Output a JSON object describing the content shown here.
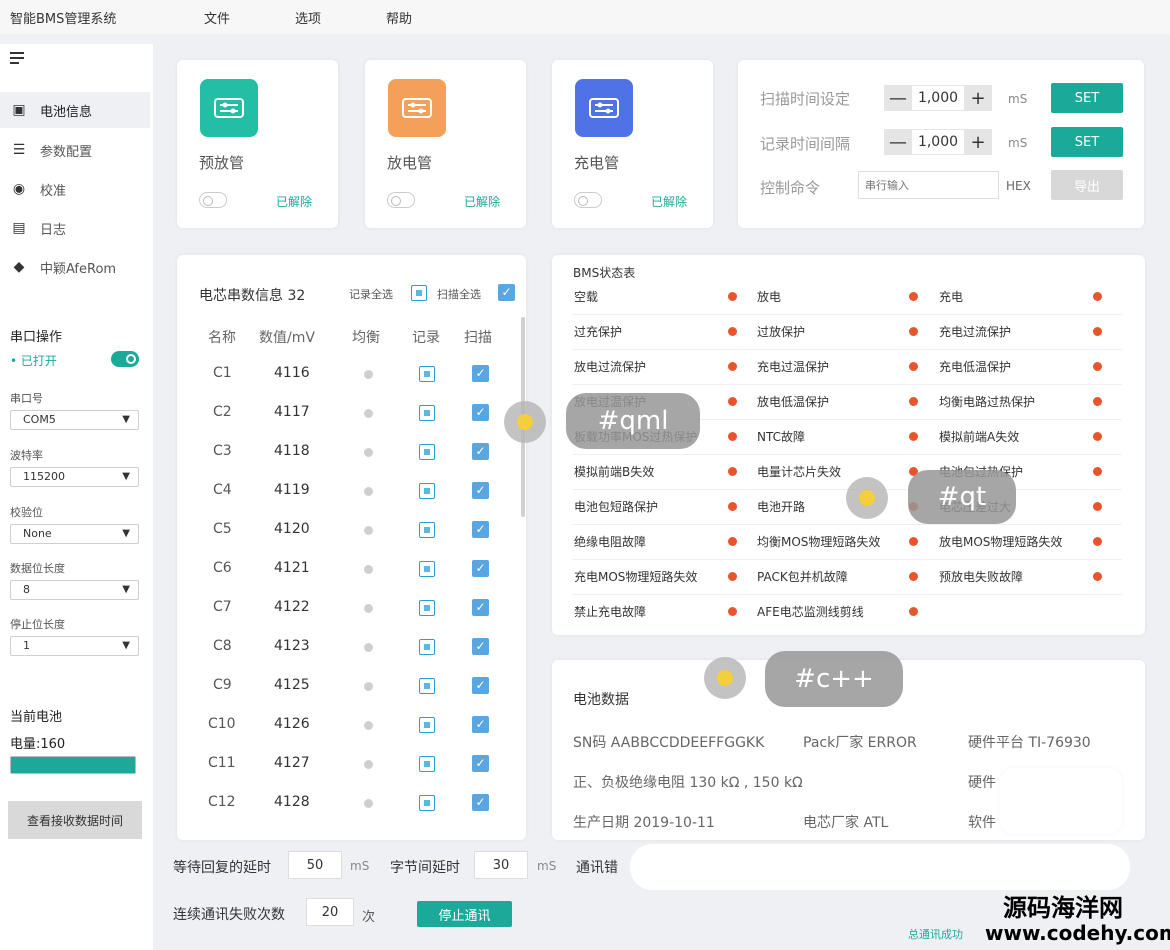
{
  "app": {
    "title": "智能BMS管理系统"
  },
  "menu": [
    "文件",
    "选项",
    "帮助"
  ],
  "sidebar": {
    "items": [
      {
        "label": "电池信息",
        "icon": "battery-icon"
      },
      {
        "label": "参数配置",
        "icon": "sliders-icon"
      },
      {
        "label": "校准",
        "icon": "target-icon"
      },
      {
        "label": "日志",
        "icon": "log-icon"
      },
      {
        "label": "中颖AfeRom",
        "icon": "chip-icon"
      }
    ],
    "serial": {
      "title": "串口操作",
      "status": "• 已打开",
      "port_label": "串口号",
      "port_value": "COM5",
      "baud_label": "波特率",
      "baud_value": "115200",
      "parity_label": "校验位",
      "parity_value": "None",
      "databits_label": "数据位长度",
      "databits_value": "8",
      "stopbits_label": "停止位长度",
      "stopbits_value": "1"
    },
    "battery": {
      "title": "当前电池",
      "level_label": "电量:160",
      "level_fraction": 1.0
    },
    "view_button": "查看接收数据时间"
  },
  "switches": [
    {
      "label": "预放管",
      "status": "已解除",
      "color": "#22bfa5"
    },
    {
      "label": "放电管",
      "status": "已解除",
      "color": "#f5a05a"
    },
    {
      "label": "充电管",
      "status": "已解除",
      "color": "#4f73e6"
    }
  ],
  "controls": {
    "scan_label": "扫描时间设定",
    "scan_value": "1,000",
    "scan_unit": "mS",
    "record_label": "记录时间间隔",
    "record_value": "1,000",
    "record_unit": "mS",
    "set_label": "SET",
    "cmd_label": "控制命令",
    "cmd_placeholder": "串行输入",
    "cmd_unit": "HEX",
    "export_label": "导出",
    "minus": "—",
    "plus": "+"
  },
  "cells": {
    "title": "电芯串数信息 32",
    "record_all": "记录全选",
    "scan_all": "扫描全选",
    "headers": [
      "名称",
      "数值/mV",
      "均衡",
      "记录",
      "扫描"
    ],
    "rows": [
      {
        "name": "C1",
        "value": "4116"
      },
      {
        "name": "C2",
        "value": "4117"
      },
      {
        "name": "C3",
        "value": "4118"
      },
      {
        "name": "C4",
        "value": "4119"
      },
      {
        "name": "C5",
        "value": "4120"
      },
      {
        "name": "C6",
        "value": "4121"
      },
      {
        "name": "C7",
        "value": "4122"
      },
      {
        "name": "C8",
        "value": "4123"
      },
      {
        "name": "C9",
        "value": "4125"
      },
      {
        "name": "C10",
        "value": "4126"
      },
      {
        "name": "C11",
        "value": "4127"
      },
      {
        "name": "C12",
        "value": "4128"
      }
    ]
  },
  "status_table": {
    "title": "BMS状态表",
    "rows": [
      [
        "空载",
        "放电",
        "充电"
      ],
      [
        "过充保护",
        "过放保护",
        "充电过流保护"
      ],
      [
        "放电过流保护",
        "充电过温保护",
        "充电低温保护"
      ],
      [
        "放电过温保护",
        "放电低温保护",
        "均衡电路过热保护"
      ],
      [
        "板载功率MOS过热保护",
        "NTC故障",
        "模拟前端A失效"
      ],
      [
        "模拟前端B失效",
        "电量计芯片失效",
        "电池包过热保护"
      ],
      [
        "电池包短路保护",
        "电池开路",
        "电芯压差过大"
      ],
      [
        "绝缘电阻故障",
        "均衡MOS物理短路失效",
        "放电MOS物理短路失效"
      ],
      [
        "充电MOS物理短路失效",
        "PACK包并机故障",
        "预放电失败故障"
      ],
      [
        "禁止充电故障",
        "AFE电芯监测线剪线",
        ""
      ]
    ],
    "dot_color": "#e8552c"
  },
  "battery_data": {
    "title": "电池数据",
    "sn": "SN码  AABBCCDDEEFFGGKK",
    "pack": "Pack厂家  ERROR",
    "hw_platform": "硬件平台  TI-76930",
    "insulation": "正、负极绝缘电阻  130 kΩ , 150 kΩ",
    "hw_version": "硬件",
    "date": "生产日期  2019-10-11",
    "cell_maker": "电芯厂家  ATL",
    "sw_version": "软件"
  },
  "comm": {
    "reply_delay_label": "等待回复的延时",
    "reply_delay_value": "50",
    "unit_ms": "mS",
    "byte_delay_label": "字节间延时",
    "byte_delay_value": "30",
    "error_label": "通讯错",
    "fail_count_label": "连续通讯失败次数",
    "fail_count_value": "20",
    "fail_count_unit": "次",
    "stop_button": "停止通讯",
    "total_status": "总通讯成功"
  },
  "overlay": {
    "tags": [
      "#qml",
      "#qt",
      "#c++"
    ],
    "watermark_cn": "源码海洋网",
    "watermark_url": "www.codehy.com"
  }
}
